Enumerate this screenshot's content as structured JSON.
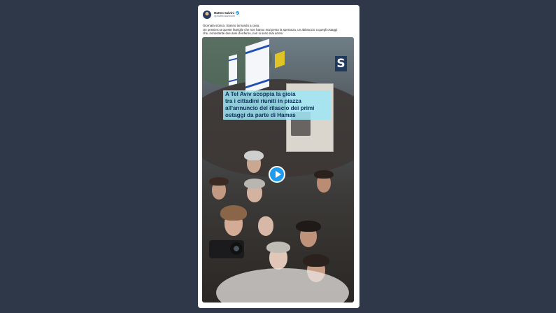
{
  "tweet": {
    "author": {
      "display_name": "Matteo Salvini",
      "handle": "@matteosalvinimi",
      "verified": true
    },
    "text": [
      "Giornata storica. Stanno tornando a casa.",
      "Un pensiero a queste famiglie che non hanno mai perso la speranza, un abbraccio a quegli ostaggi",
      "che, nonostante due anni di inferno, non si sono mai arresi."
    ],
    "media": {
      "type": "video",
      "caption_lines": [
        "A Tel Aviv scoppia la gioia",
        "tra i cittadini riuniti in piazza",
        "all'annuncio del rilascio dei primi",
        "ostaggi da parte di Hamas"
      ],
      "logo_letter": "S",
      "play_icon": "play-icon"
    }
  },
  "colors": {
    "page_background": "#2f3848",
    "card_background": "#ffffff",
    "accent": "#1d9bf0",
    "caption_background": "#a0e6f5",
    "caption_text": "#0b2e5a"
  }
}
